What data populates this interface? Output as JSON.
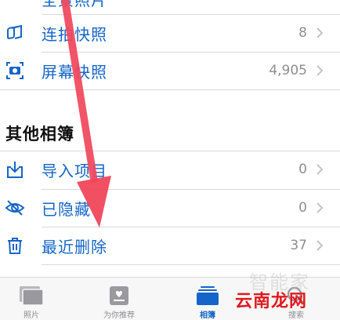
{
  "top_partial_label": "全景照片",
  "rows_top": [
    {
      "label": "连拍快照",
      "count": "8",
      "icon": "burst-icon"
    },
    {
      "label": "屏幕快照",
      "count": "4,905",
      "icon": "screenshot-icon"
    }
  ],
  "section_title": "其他相簿",
  "rows_other": [
    {
      "label": "导入项目",
      "count": "0",
      "icon": "import-icon"
    },
    {
      "label": "已隐藏",
      "count": "0",
      "icon": "hidden-eye-icon"
    },
    {
      "label": "最近删除",
      "count": "37",
      "icon": "trash-icon"
    }
  ],
  "tabs": [
    {
      "label": "照片",
      "icon": "photos-tab-icon",
      "active": false
    },
    {
      "label": "为你推荐",
      "icon": "for-you-tab-icon",
      "active": false
    },
    {
      "label": "相簿",
      "icon": "albums-tab-icon",
      "active": true
    },
    {
      "label": "搜索",
      "icon": "search-tab-icon",
      "active": false
    }
  ],
  "watermark": {
    "text": "云南龙网",
    "logo": "智能家"
  },
  "colors": {
    "accent": "#1565c8",
    "arrow": "#f0465a",
    "watermark": "#e0191f"
  }
}
